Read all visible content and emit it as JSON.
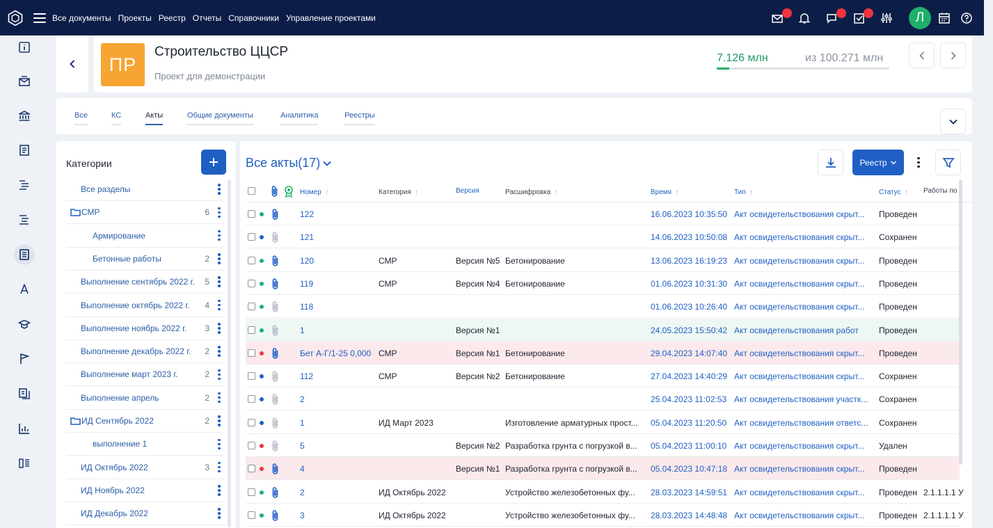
{
  "topbar": {
    "menu": [
      "Все документы",
      "Проекты",
      "Реестр",
      "Отчеты",
      "Справочники",
      "Управление проектами"
    ],
    "avatar_letter": "Л"
  },
  "project": {
    "badge": "ПР",
    "title": "Строительство ЦЦСР",
    "subtitle": "Проект для демонстрации",
    "budget_value": "7.126 млн",
    "budget_total": "из 100.271 млн",
    "budget_progress": 0.071
  },
  "tabs": [
    {
      "label": "Все",
      "active": false
    },
    {
      "label": "КС",
      "active": false
    },
    {
      "label": "Акты",
      "active": true
    },
    {
      "label": "Общие документы",
      "active": false
    },
    {
      "label": "Аналитика",
      "active": false
    },
    {
      "label": "Реестры",
      "active": false
    }
  ],
  "categories": {
    "title": "Категории",
    "items": [
      {
        "label": "Все разделы",
        "count": "",
        "folder": false,
        "indent": 1
      },
      {
        "label": "СМР",
        "count": "6",
        "folder": true,
        "indent": 0
      },
      {
        "label": "Армирование",
        "count": "",
        "folder": false,
        "indent": 2
      },
      {
        "label": "Бетонные работы",
        "count": "2",
        "folder": false,
        "indent": 2
      },
      {
        "label": "Выполнение сентябрь 2022 г.",
        "count": "5",
        "folder": false,
        "indent": 1
      },
      {
        "label": "Выполнение октябрь 2022 г.",
        "count": "4",
        "folder": false,
        "indent": 1
      },
      {
        "label": "Выполнение ноябрь 2022 г.",
        "count": "3",
        "folder": false,
        "indent": 1
      },
      {
        "label": "Выполнение декабрь 2022 г.",
        "count": "2",
        "folder": false,
        "indent": 1
      },
      {
        "label": "Выполнение март 2023 г.",
        "count": "2",
        "folder": false,
        "indent": 1
      },
      {
        "label": "Выполнение апрель",
        "count": "2",
        "folder": false,
        "indent": 1
      },
      {
        "label": "ИД Сентябрь 2022",
        "count": "2",
        "folder": true,
        "indent": 0
      },
      {
        "label": "выполнение 1",
        "count": "",
        "folder": false,
        "indent": 2
      },
      {
        "label": "ИД Октябрь 2022",
        "count": "3",
        "folder": false,
        "indent": 1
      },
      {
        "label": "ИД Ноябрь 2022",
        "count": "",
        "folder": false,
        "indent": 1
      },
      {
        "label": "ИД Декабрь 2022",
        "count": "",
        "folder": false,
        "indent": 1
      }
    ]
  },
  "acts": {
    "title": "Все акты(17)",
    "registry_button": "Реестр",
    "columns": {
      "number": "Номер",
      "category": "Категория",
      "version": "Версия",
      "decoding": "Расшифровка",
      "time": "Время",
      "type": "Тип",
      "status": "Статус",
      "works": "Работы по"
    },
    "rows": [
      {
        "dot": "#1faf6b",
        "clip": true,
        "number": "122",
        "category": "",
        "version": "",
        "decoding": "",
        "time": "16.06.2023 10:35:50",
        "type": "Акт освидетельствования скрыт...",
        "status": "Проведен",
        "works": "",
        "bg": ""
      },
      {
        "dot": "#1f5fc4",
        "clip": false,
        "number": "121",
        "category": "",
        "version": "",
        "decoding": "",
        "time": "14.06.2023 10:50:08",
        "type": "Акт освидетельствования скрыт...",
        "status": "Сохранен",
        "works": "",
        "bg": ""
      },
      {
        "dot": "#1faf6b",
        "clip": true,
        "number": "120",
        "category": "СМР",
        "version": "Версия №5",
        "decoding": "Бетонирование",
        "time": "13.06.2023 16:19:23",
        "type": "Акт освидетельствования скрыт...",
        "status": "Проведен",
        "works": "",
        "bg": ""
      },
      {
        "dot": "#1faf6b",
        "clip": true,
        "number": "119",
        "category": "СМР",
        "version": "Версия №4",
        "decoding": "Бетонирование",
        "time": "01.06.2023 10:31:30",
        "type": "Акт освидетельствования скрыт...",
        "status": "Проведен",
        "works": "",
        "bg": ""
      },
      {
        "dot": "#1faf6b",
        "clip": false,
        "number": "118",
        "category": "",
        "version": "",
        "decoding": "",
        "time": "01.06.2023 10:26:40",
        "type": "Акт освидетельствования скрыт...",
        "status": "Проведен",
        "works": "",
        "bg": ""
      },
      {
        "dot": "#1faf6b",
        "clip": false,
        "number": "1",
        "category": "",
        "version": "Версия №1",
        "decoding": "",
        "time": "24.05.2023 15:50:42",
        "type": "Акт освидетельствования работ",
        "status": "Проведен",
        "works": "",
        "bg": "mint"
      },
      {
        "dot": "#ef3340",
        "clip": true,
        "number": "Бет А-Г/1-25 0,000",
        "category": "СМР",
        "version": "Версия №1",
        "decoding": "Бетонирование",
        "time": "29.04.2023 14:07:40",
        "type": "Акт освидетельствования скрыт...",
        "status": "Проведен",
        "works": "",
        "bg": "pink"
      },
      {
        "dot": "#1f5fc4",
        "clip": false,
        "number": "112",
        "category": "СМР",
        "version": "Версия №2",
        "decoding": "Бетонирование",
        "time": "27.04.2023 14:40:29",
        "type": "Акт освидетельствования скрыт...",
        "status": "Сохранен",
        "works": "",
        "bg": ""
      },
      {
        "dot": "#1f5fc4",
        "clip": false,
        "number": "2",
        "category": "",
        "version": "",
        "decoding": "",
        "time": "25.04.2023 11:02:53",
        "type": "Акт освидетельствования участк...",
        "status": "Сохранен",
        "works": "",
        "bg": ""
      },
      {
        "dot": "#1f5fc4",
        "clip": false,
        "number": "1",
        "category": "ИД Март 2023",
        "version": "",
        "decoding": "Изготовление арматурных прост...",
        "time": "05.04.2023 11:20:50",
        "type": "Акт освидетельствования ответс...",
        "status": "Сохранен",
        "works": "",
        "bg": ""
      },
      {
        "dot": "#ef3340",
        "clip": false,
        "number": "5",
        "category": "",
        "version": "Версия №2",
        "decoding": "Разработка грунта с погрузкой в...",
        "time": "05.04.2023 11:00:10",
        "type": "Акт освидетельствования скрыт...",
        "status": "Удален",
        "works": "",
        "bg": ""
      },
      {
        "dot": "#ef3340",
        "clip": true,
        "number": "4",
        "category": "",
        "version": "Версия №1",
        "decoding": "Разработка грунта с погрузкой в...",
        "time": "05.04.2023 10:47:18",
        "type": "Акт освидетельствования скрыт...",
        "status": "Проведен",
        "works": "",
        "bg": "pink"
      },
      {
        "dot": "#1faf6b",
        "clip": true,
        "number": "2",
        "category": "ИД Октябрь 2022",
        "version": "",
        "decoding": "Устройство железобетонных фу...",
        "time": "28.03.2023 14:59:51",
        "type": "Акт освидетельствования скрыт...",
        "status": "Проведен",
        "works": "2.1.1.1.1 У",
        "bg": ""
      },
      {
        "dot": "#1faf6b",
        "clip": true,
        "number": "3",
        "category": "ИД Октябрь 2022",
        "version": "",
        "decoding": "Устройство железобетонных фу...",
        "time": "28.03.2023 14:48:48",
        "type": "Акт освидетельствования скрыт...",
        "status": "Проведен",
        "works": "2.1.1.1.1 У",
        "bg": ""
      }
    ]
  }
}
